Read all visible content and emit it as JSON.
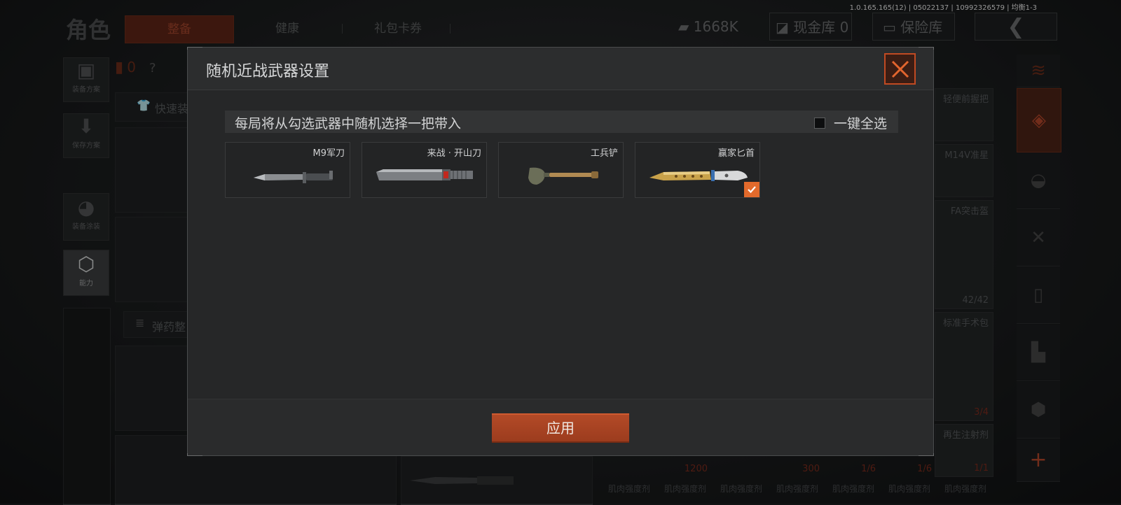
{
  "version_text": "1.0.165.165(12) | 05022137 | 10992326579 | 均衡1-3",
  "background": {
    "page_title": "角色",
    "tabs": [
      {
        "label": "整备",
        "active": true
      },
      {
        "label": "健康",
        "active": false
      },
      {
        "label": "礼包卡券",
        "active": false
      }
    ],
    "currency": "1668K",
    "cash_stash": "现金库 0",
    "safe_box": "保险库",
    "left_menu": [
      {
        "label": "装备方案",
        "icon": "backpack-icon"
      },
      {
        "label": "保存方案",
        "icon": "download-icon"
      },
      {
        "label": "装备涂装",
        "icon": "helmet-icon"
      },
      {
        "label": "能力",
        "icon": "lightning-hex-icon",
        "active": true
      }
    ],
    "armor_count": "0",
    "quick_equip_label": "快速装",
    "ammo_label": "弹药整",
    "right_items": [
      {
        "name": "轻便前握把",
        "qty": ""
      },
      {
        "name": "M14V准星",
        "qty": ""
      },
      {
        "name": "FA突击盔",
        "qty": "42/42"
      },
      {
        "name": "标准手术包",
        "qty": "3/4"
      },
      {
        "name": "再生注射剂",
        "qty": "1/1"
      }
    ],
    "bottom_counts": [
      "1200",
      "300",
      "1/6",
      "1/6"
    ],
    "bottom_labels": [
      "肌肉强度剂",
      "肌肉强度剂",
      "肌肉强度剂",
      "肌肉强度剂",
      "肌肉强度剂",
      "肌肉强度剂",
      "肌肉强度剂"
    ]
  },
  "modal": {
    "title": "随机近战武器设置",
    "instruction": "每局将从勾选武器中随机选择一把带入",
    "select_all_label": "一键全选",
    "select_all_checked": false,
    "weapons": [
      {
        "name": "M9军刀",
        "icon": "bayonet-icon",
        "checked": false
      },
      {
        "name": "来战 · 开山刀",
        "icon": "machete-icon",
        "checked": false
      },
      {
        "name": "工兵铲",
        "icon": "shovel-icon",
        "checked": false
      },
      {
        "name": "赢家匕首",
        "icon": "gold-dagger-icon",
        "checked": true
      }
    ],
    "apply_label": "应用",
    "colors": {
      "accent": "#e26a2c",
      "close_border": "#c14a22",
      "apply_bg": "#a9421f"
    }
  }
}
